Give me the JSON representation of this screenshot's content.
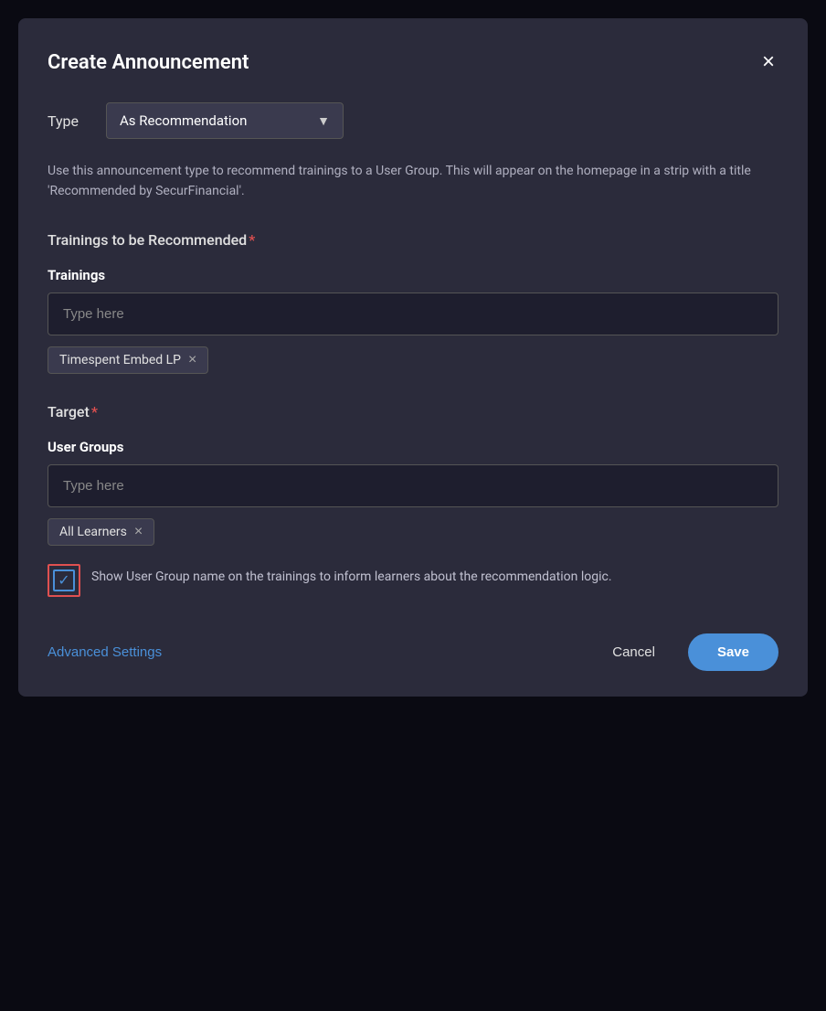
{
  "modal": {
    "title": "Create Announcement",
    "close_icon": "×"
  },
  "type_field": {
    "label": "Type",
    "value": "As Recommendation",
    "dropdown_arrow": "▼"
  },
  "description": "Use this announcement type to recommend trainings to a User Group. This will appear on the homepage in a strip with a title 'Recommended by SecurFinancial'.",
  "trainings_section": {
    "title": "Trainings to be Recommended",
    "required": "*",
    "field_label": "Trainings",
    "placeholder": "Type here",
    "tags": [
      {
        "label": "Timespent Embed LP"
      }
    ]
  },
  "target_section": {
    "title": "Target",
    "required": "*",
    "user_groups": {
      "field_label": "User Groups",
      "placeholder": "Type here",
      "tags": [
        {
          "label": "All Learners"
        }
      ]
    },
    "checkbox": {
      "checked": true,
      "label": "Show User Group name on the trainings to inform learners about the recommendation logic."
    }
  },
  "footer": {
    "advanced_settings_label": "Advanced Settings",
    "cancel_label": "Cancel",
    "save_label": "Save"
  }
}
